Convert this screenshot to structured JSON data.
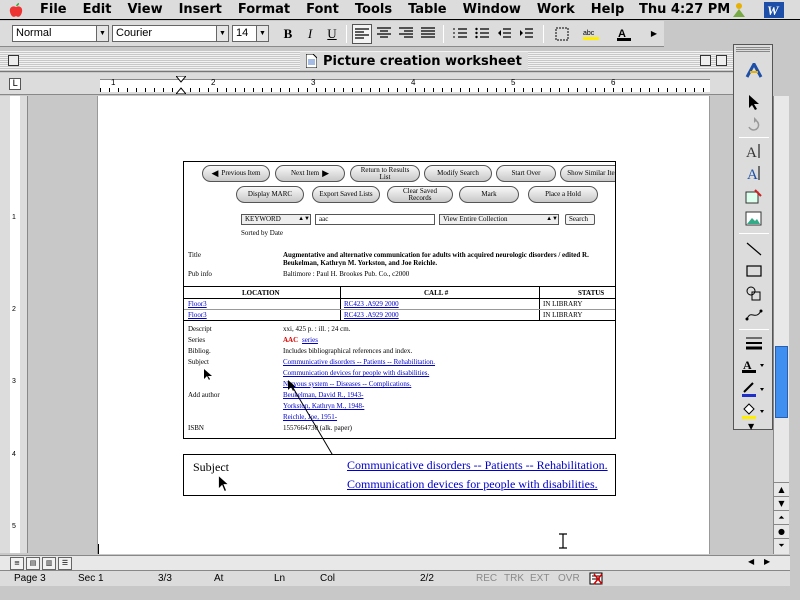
{
  "menubar": {
    "items": [
      "File",
      "Edit",
      "View",
      "Insert",
      "Format",
      "Font",
      "Tools",
      "Table",
      "Window",
      "Work",
      "Help"
    ],
    "clock": "Thu 4:27 PM"
  },
  "format_toolbar": {
    "style": "Normal",
    "font": "Courier",
    "size": "14",
    "bold": "B",
    "italic": "I",
    "underline": "U"
  },
  "window": {
    "title": "Picture creation worksheet"
  },
  "ruler": {
    "numbers": [
      "1",
      "2",
      "3",
      "4",
      "5",
      "6"
    ]
  },
  "vruler": {
    "numbers": [
      "1",
      "2",
      "3",
      "4",
      "5"
    ]
  },
  "catalog": {
    "nav_buttons": [
      "Previous Item",
      "Next Item",
      "Return to Results List",
      "Modify Search",
      "Start Over",
      "Show Similar Items"
    ],
    "action_buttons": [
      "Display MARC",
      "Export Saved Lists",
      "Clear Saved Records",
      "Mark",
      "Place a Hold"
    ],
    "search_field_select": "KEYWORD",
    "search_term": "aac",
    "view_select": "View Entire Collection",
    "search_button": "Search",
    "sorted_by": "Sorted by Date",
    "title_label": "Title",
    "title_value": "Augmentative and alternative communication for adults with acquired neurologic disorders / edited R. Beukelman, Kathryn M. Yorkston, and Joe Reichle.",
    "pubinfo_label": "Pub info",
    "pubinfo_value": "Baltimore : Paul H. Brookes Pub. Co., c2000",
    "holdings_headers": [
      "LOCATION",
      "CALL #",
      "STATUS"
    ],
    "holdings_rows": [
      [
        "Floor3",
        "RC423 .A929 2000",
        "IN LIBRARY"
      ],
      [
        "Floor3",
        "RC423 .A929 2000",
        "IN LIBRARY"
      ]
    ],
    "descript_label": "Descript",
    "descript_value": "xxi, 425 p. : ill. ; 24 cm.",
    "series_label": "Series",
    "series_prefix": "AAC",
    "series_link": "series",
    "bibliog_label": "Bibliog.",
    "bibliog_value": "Includes bibliographical references and index.",
    "subject_label": "Subject",
    "subjects": [
      "Communicative disorders -- Patients -- Rehabilitation.",
      "Communication devices for people with disabilities.",
      "Nervous system -- Diseases -- Complications."
    ],
    "addauthor_label": "Add author",
    "authors": [
      "Beukelman, David R., 1943-",
      "Yorkston, Kathryn M., 1948-",
      "Reichle, Joe, 1951-"
    ],
    "isbn_label": "ISBN",
    "isbn_value": "1557664730 (alk. paper)"
  },
  "subject_box": {
    "label": "Subject",
    "links": [
      "Communicative disorders -- Patients -- Rehabilitation.",
      "Communication devices for people with disabilities."
    ]
  },
  "status": {
    "page": "Page 3",
    "sec": "Sec 1",
    "pages": "3/3",
    "at": "At",
    "ln": "Ln",
    "col": "Col",
    "words": "2/2",
    "rec": "REC",
    "trk": "TRK",
    "ext": "EXT",
    "ovr": "OVR"
  }
}
